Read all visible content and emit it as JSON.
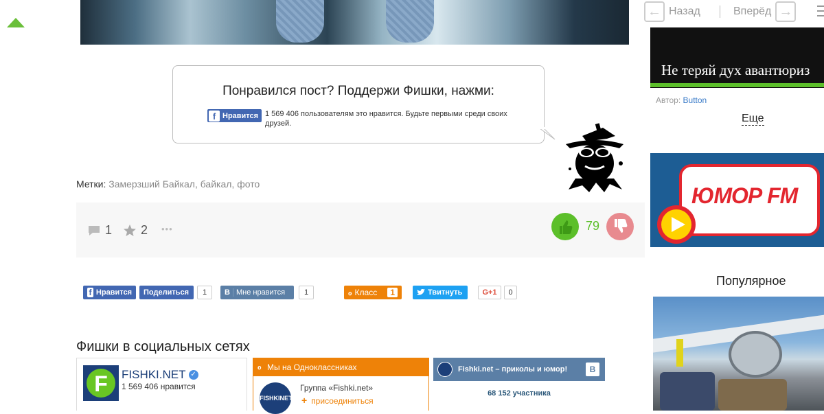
{
  "nav": {
    "back_label": "Назад",
    "forward_label": "Вперёд"
  },
  "like_prompt": {
    "title": "Понравился пост? Поддержи Фишки, нажми:",
    "fb_button": "Нравится",
    "count_text": "1 569 406 пользователям это нравится. Будьте первыми среди своих друзей."
  },
  "tags": {
    "label": "Метки:",
    "items": [
      "Замерзший Байкал",
      "байкал",
      "фото"
    ],
    "separator": ", "
  },
  "stats": {
    "comments": "1",
    "favorites": "2",
    "more": "•••",
    "likes": "79"
  },
  "share": {
    "fb_like": "Нравится",
    "fb_share": "Поделиться",
    "fb_count": "1",
    "vk_like": "Мне нравится",
    "vk_count": "1",
    "ok_label": "Класс",
    "ok_count": "1",
    "tw_label": "Твитнуть",
    "gplus_label": "G+1",
    "gplus_count": "0"
  },
  "social": {
    "title": "Фишки в социальных сетях",
    "fb": {
      "name": "FISHKI.NET",
      "count": "1 569 406 нравится"
    },
    "ok": {
      "header": "Мы на Одноклассниках",
      "group": "Группа «Fishki.net»",
      "join": "присоединиться",
      "logo": "FISHKINET"
    },
    "vk": {
      "title": "Fishki.net – приколы и юмор!",
      "members": "68 152 участника",
      "badge": "В"
    }
  },
  "sidebar": {
    "promo1_text": "Не теряй дух авантюриз",
    "author_label": "Автор:",
    "author_name": "Button",
    "more": "Еще",
    "promo2_brand": "ЮМОР FM",
    "popular_title": "Популярное"
  },
  "colors": {
    "green": "#5cbf2a",
    "fb": "#4267b2",
    "vk": "#5b7fa6",
    "ok": "#ee8208",
    "twitter": "#1da1f2",
    "dislike": "#e88a8f"
  }
}
